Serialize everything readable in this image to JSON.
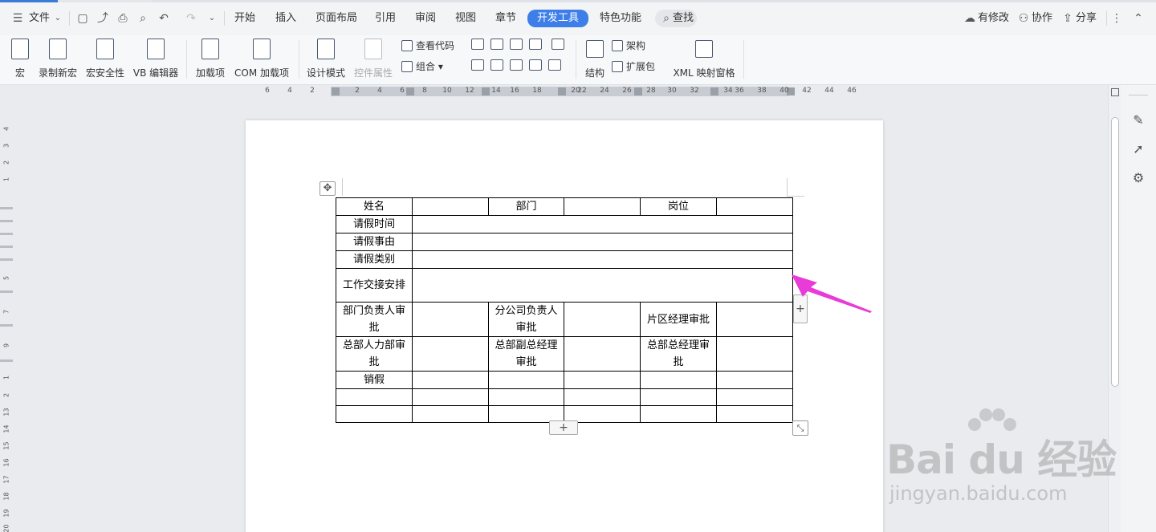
{
  "menubar": {
    "file_label": "文件",
    "tabs": [
      "开始",
      "插入",
      "页面布局",
      "引用",
      "审阅",
      "视图",
      "章节",
      "开发工具",
      "特色功能"
    ],
    "active_tab": "开发工具",
    "search_label": "查找",
    "right": {
      "modified": "有修改",
      "collab": "协作",
      "share": "分享"
    }
  },
  "ribbon": {
    "macro": "宏",
    "record_macro": "录制新宏",
    "macro_security": "宏安全性",
    "vb_editor": "VB 编辑器",
    "addins": "加载项",
    "com_addins": "COM 加载项",
    "design_mode": "设计模式",
    "control_props": "控件属性",
    "view_code": "查看代码",
    "group": "组合",
    "structure": "结构",
    "schema": "架构",
    "expansion": "扩展包",
    "xml_pane": "XML 映射窗格"
  },
  "ruler": {
    "h_ticks": [
      "6",
      "4",
      "2",
      "2",
      "4",
      "6",
      "8",
      "10",
      "12",
      "14",
      "16",
      "18",
      "20",
      "22",
      "24",
      "26",
      "28",
      "30",
      "32",
      "34",
      "36",
      "38",
      "40",
      "42",
      "44",
      "46"
    ],
    "v_ticks": [
      "4",
      "3",
      "2",
      "1",
      "5",
      "7",
      "9",
      "1",
      "2",
      "13",
      "14",
      "15",
      "16",
      "17",
      "18",
      "19",
      "20"
    ]
  },
  "table": {
    "r1": {
      "name": "姓名",
      "dept": "部门",
      "position": "岗位"
    },
    "r2": "请假时间",
    "r3": "请假事由",
    "r4": "请假类别",
    "r5": "工作交接安排",
    "r6": {
      "a": "部门负责人审批",
      "b": "分公司负责人审批",
      "c": "片区经理审批"
    },
    "r7": {
      "a": "总部人力部审批",
      "b": "总部副总经理审批",
      "c": "总部总经理审批"
    },
    "r8": "销假"
  },
  "controls": {
    "add_row": "+",
    "add_col": "+"
  },
  "watermark": {
    "logo": "Bai du 经验",
    "url": "jingyan.baidu.com"
  },
  "colors": {
    "active_tab": "#3d7ee8",
    "arrow": "#e83bd8"
  }
}
